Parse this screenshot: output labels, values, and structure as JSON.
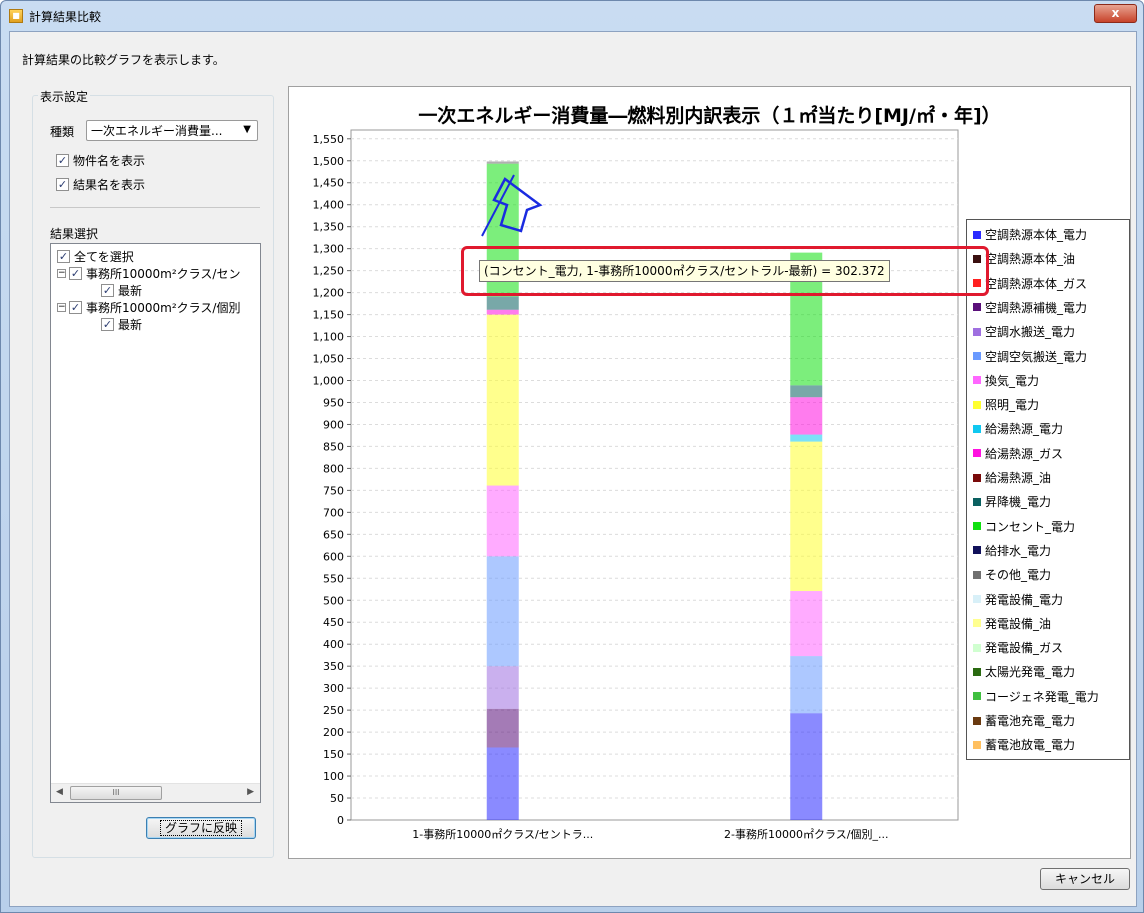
{
  "window": {
    "title": "計算結果比較",
    "close_label": "x"
  },
  "description": "計算結果の比較グラフを表示します。",
  "display_settings": {
    "group_label": "表示設定",
    "type_label": "種類",
    "type_value": "一次エネルギー消費量...",
    "show_property_name": "物件名を表示",
    "show_result_name": "結果名を表示"
  },
  "result_select": {
    "group_label": "結果選択",
    "select_all": "全てを選択",
    "items": [
      {
        "name": "事務所10000m²クラス/セン",
        "child": "最新"
      },
      {
        "name": "事務所10000m²クラス/個別",
        "child": "最新"
      }
    ],
    "scroll_thumb": "III"
  },
  "buttons": {
    "apply": "グラフに反映",
    "cancel": "キャンセル"
  },
  "tooltip": "(コンセント_電力, 1-事務所10000㎡クラス/セントラル-最新) = 302.372",
  "colors": {
    "highlight": "#e0192e",
    "annotation_arrow": "#1a2be0"
  },
  "chart_data": {
    "type": "bar",
    "stacked": true,
    "title": "一次エネルギー消費量―燃料別内訳表示（１㎡当たり[MJ/㎡・年]）",
    "categories": [
      "1-事務所10000㎡クラス/セントラ...",
      "2-事務所10000㎡クラス/個別_..."
    ],
    "ylim": [
      0,
      1570
    ],
    "ytick_step": 50,
    "grid": true,
    "legend_position": "right",
    "series": [
      {
        "name": "空調熱源本体_電力",
        "color": "#2a2aff",
        "values": [
          165,
          243
        ]
      },
      {
        "name": "空調熱源本体_油",
        "color": "#3a0f0f",
        "values": [
          0,
          0
        ]
      },
      {
        "name": "空調熱源本体_ガス",
        "color": "#ff2020",
        "values": [
          0,
          0
        ]
      },
      {
        "name": "空調熱源補機_電力",
        "color": "#5a0f7a",
        "values": [
          88,
          0
        ]
      },
      {
        "name": "空調水搬送_電力",
        "color": "#9f6fe0",
        "values": [
          97,
          0
        ]
      },
      {
        "name": "空調空気搬送_電力",
        "color": "#6a9aff",
        "values": [
          250,
          130
        ]
      },
      {
        "name": "換気_電力",
        "color": "#ff66ff",
        "values": [
          161,
          148
        ]
      },
      {
        "name": "照明_電力",
        "color": "#ffff30",
        "values": [
          389,
          340
        ]
      },
      {
        "name": "給湯熱源_電力",
        "color": "#10c8f0",
        "values": [
          0,
          16
        ]
      },
      {
        "name": "給湯熱源_ガス",
        "color": "#ff10e0",
        "values": [
          11,
          85
        ]
      },
      {
        "name": "給湯熱源_油",
        "color": "#7a0a0a",
        "values": [
          0,
          0
        ]
      },
      {
        "name": "昇降機_電力",
        "color": "#0a6060",
        "values": [
          30,
          27
        ]
      },
      {
        "name": "コンセント_電力",
        "color": "#10e010",
        "values": [
          302.372,
          302
        ]
      },
      {
        "name": "給排水_電力",
        "color": "#10105a",
        "values": [
          0,
          0
        ]
      },
      {
        "name": "その他_電力",
        "color": "#707070",
        "values": [
          5,
          0
        ]
      },
      {
        "name": "発電設備_電力",
        "color": "#d8f0f8",
        "values": [
          0,
          0
        ]
      },
      {
        "name": "発電設備_油",
        "color": "#ffff90",
        "values": [
          0,
          0
        ]
      },
      {
        "name": "発電設備_ガス",
        "color": "#d0ffd0",
        "values": [
          0,
          0
        ]
      },
      {
        "name": "太陽光発電_電力",
        "color": "#2a6a10",
        "values": [
          0,
          0
        ]
      },
      {
        "name": "コージェネ発電_電力",
        "color": "#40c040",
        "values": [
          0,
          0
        ]
      },
      {
        "name": "蓄電池充電_電力",
        "color": "#6a3a10",
        "values": [
          0,
          0
        ]
      },
      {
        "name": "蓄電池放電_電力",
        "color": "#ffc060",
        "values": [
          0,
          0
        ]
      }
    ]
  }
}
